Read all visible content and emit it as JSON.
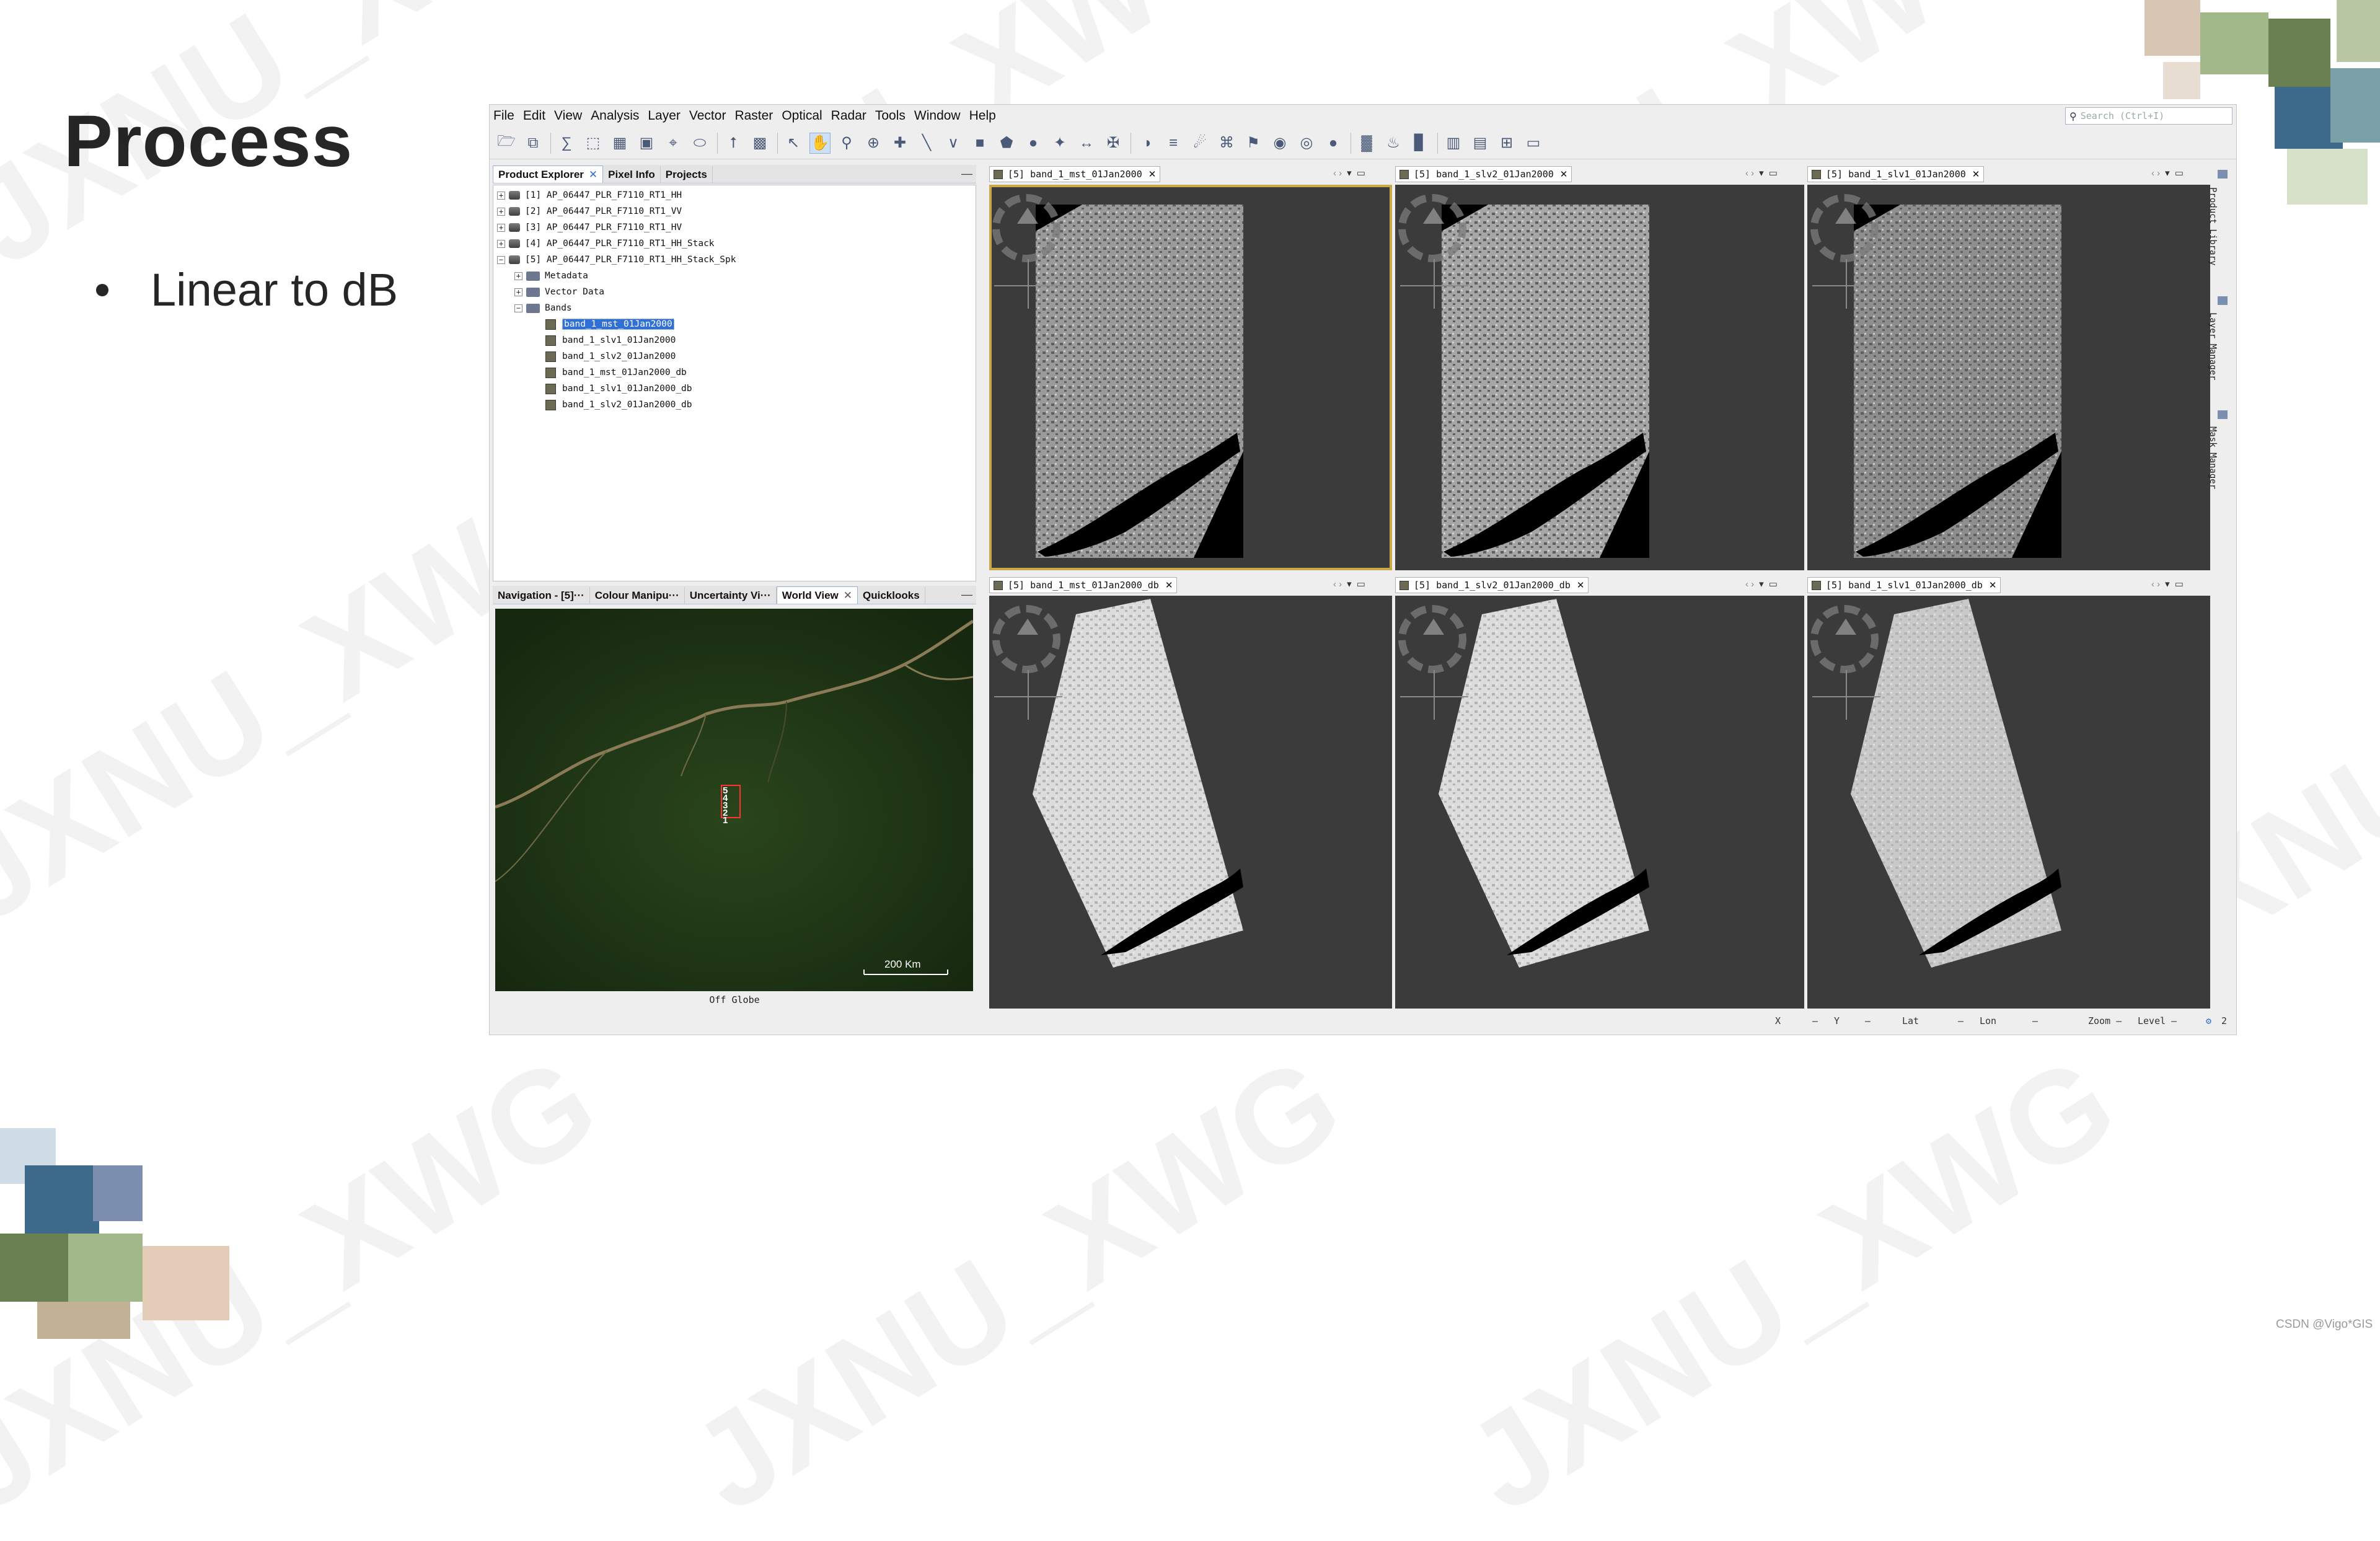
{
  "slide": {
    "title": "Process",
    "bullet": "Linear to dB",
    "watermark": "JXNU_XWG",
    "credit": "CSDN @Vigo*GIS"
  },
  "app": {
    "menu": [
      "File",
      "Edit",
      "View",
      "Analysis",
      "Layer",
      "Vector",
      "Raster",
      "Optical",
      "Radar",
      "Tools",
      "Window",
      "Help"
    ],
    "search_placeholder": "Search (Ctrl+I)",
    "toolbar_icons": [
      "open-product-icon",
      "product-library-icon",
      "sep",
      "band-maths-icon",
      "subset-icon",
      "grid-icon",
      "mosaic-icon",
      "gcp-icon",
      "warp-icon",
      "sep",
      "graph-builder-icon",
      "batch-icon",
      "sep",
      "select-tool-icon",
      "pan-tool-icon",
      "zoom-tool-icon",
      "zoom-in-tool-icon",
      "gcp-tool-icon",
      "line-tool-icon",
      "polyline-tool-icon",
      "rect-tool-icon",
      "polygon-tool-icon",
      "ellipse-tool-icon",
      "magic-wand-icon",
      "range-finder-icon",
      "pin-tool-icon",
      "sep",
      "globe-icon",
      "layers-icon",
      "satellite-icon",
      "gcp-manager-icon",
      "pin-manager-icon",
      "eye-icon",
      "world-map-icon",
      "night-globe-icon",
      "sep",
      "chart-icon",
      "flame-icon",
      "histogram-icon",
      "sep",
      "tile-horizontal-icon",
      "tile-vertical-icon",
      "tile-grid-icon",
      "folder-icon"
    ],
    "explorer": {
      "tabs": [
        "Product Explorer",
        "Pixel Info",
        "Projects"
      ],
      "products": [
        "[1] AP_06447_PLR_F7110_RT1_HH",
        "[2] AP_06447_PLR_F7110_RT1_VV",
        "[3] AP_06447_PLR_F7110_RT1_HV",
        "[4] AP_06447_PLR_F7110_RT1_HH_Stack",
        "[5] AP_06447_PLR_F7110_RT1_HH_Stack_Spk"
      ],
      "folders": [
        "Metadata",
        "Vector Data",
        "Bands"
      ],
      "bands": [
        "band_1_mst_01Jan2000",
        "band_1_slv1_01Jan2000",
        "band_1_slv2_01Jan2000",
        "band_1_mst_01Jan2000_db",
        "band_1_slv1_01Jan2000_db",
        "band_1_slv2_01Jan2000_db"
      ]
    },
    "nav_panel": {
      "tabs": [
        "Navigation - [5]···",
        "Colour Manipu···",
        "Uncertainty Vi···",
        "World View",
        "Quicklooks"
      ],
      "scale": "200 Km",
      "footer": "Off Globe",
      "footprint_labels": [
        "5",
        "4",
        "3",
        "2",
        "1"
      ]
    },
    "views": [
      {
        "tab": "[5] band_1_mst_01Jan2000"
      },
      {
        "tab": "[5] band_1_slv2_01Jan2000"
      },
      {
        "tab": "[5] band_1_slv1_01Jan2000"
      },
      {
        "tab": "[5] band_1_mst_01Jan2000_db"
      },
      {
        "tab": "[5] band_1_slv2_01Jan2000_db"
      },
      {
        "tab": "[5] band_1_slv1_01Jan2000_db"
      }
    ],
    "sidebar": [
      "Product Library",
      "Layer Manager",
      "Mask Manager"
    ],
    "status": [
      "X",
      "—",
      "Y",
      "—",
      "Lat",
      "—",
      "Lon",
      "—",
      "Zoom —",
      "Level —",
      "2"
    ]
  }
}
